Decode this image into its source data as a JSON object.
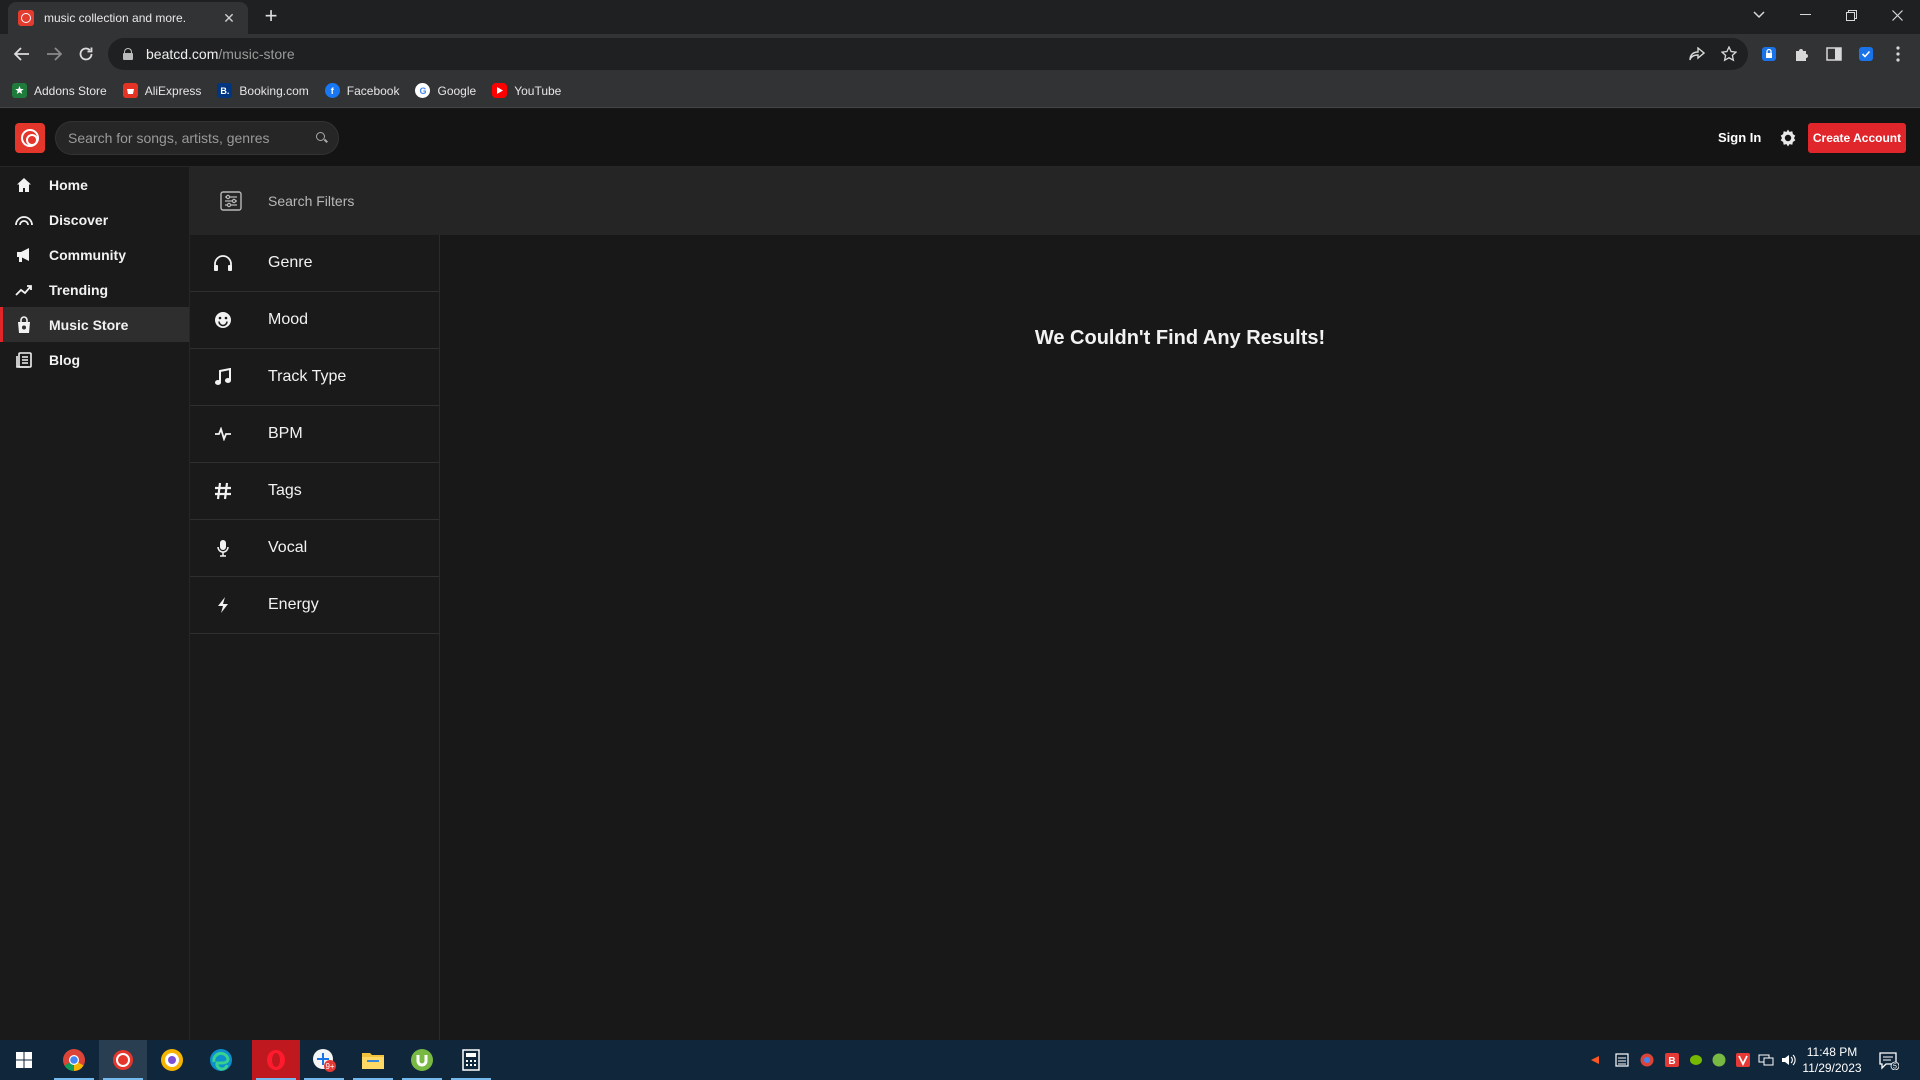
{
  "browser": {
    "tab_title": "music collection and more.",
    "url_host": "beatcd.com",
    "url_path": "/music-store",
    "bookmarks": [
      {
        "label": "Addons Store",
        "icon": "addons-store-icon",
        "color": "#1e7b3c"
      },
      {
        "label": "AliExpress",
        "icon": "aliexpress-icon",
        "color": "#e43225"
      },
      {
        "label": "Booking.com",
        "icon": "booking-icon",
        "color": "#003580",
        "glyph": "B."
      },
      {
        "label": "Facebook",
        "icon": "facebook-icon",
        "color": "#1877f2",
        "glyph": "f"
      },
      {
        "label": "Google",
        "icon": "google-icon",
        "color": "#ffffff",
        "glyph": "G"
      },
      {
        "label": "YouTube",
        "icon": "youtube-icon",
        "color": "#ff0000"
      }
    ]
  },
  "header": {
    "search_placeholder": "Search for songs, artists, genres",
    "sign_in": "Sign In",
    "create_account": "Create Account",
    "accent": "#e0262b"
  },
  "nav": {
    "items": [
      {
        "label": "Home",
        "icon": "home-icon",
        "active": false
      },
      {
        "label": "Discover",
        "icon": "discover-icon",
        "active": false
      },
      {
        "label": "Community",
        "icon": "megaphone-icon",
        "active": false
      },
      {
        "label": "Trending",
        "icon": "trending-icon",
        "active": false
      },
      {
        "label": "Music Store",
        "icon": "store-bag-icon",
        "active": true
      },
      {
        "label": "Blog",
        "icon": "blog-icon",
        "active": false
      }
    ]
  },
  "filters": {
    "title": "Search Filters",
    "items": [
      {
        "label": "Genre",
        "icon": "headphones-icon"
      },
      {
        "label": "Mood",
        "icon": "smiley-icon"
      },
      {
        "label": "Track Type",
        "icon": "music-note-icon"
      },
      {
        "label": "BPM",
        "icon": "pulse-icon"
      },
      {
        "label": "Tags",
        "icon": "hashtag-icon"
      },
      {
        "label": "Vocal",
        "icon": "microphone-icon"
      },
      {
        "label": "Energy",
        "icon": "lightning-icon"
      }
    ]
  },
  "results": {
    "empty_message": "We Couldn't Find Any Results!"
  },
  "taskbar": {
    "time": "11:48 PM",
    "date": "11/29/2023",
    "notification_count": "5"
  }
}
